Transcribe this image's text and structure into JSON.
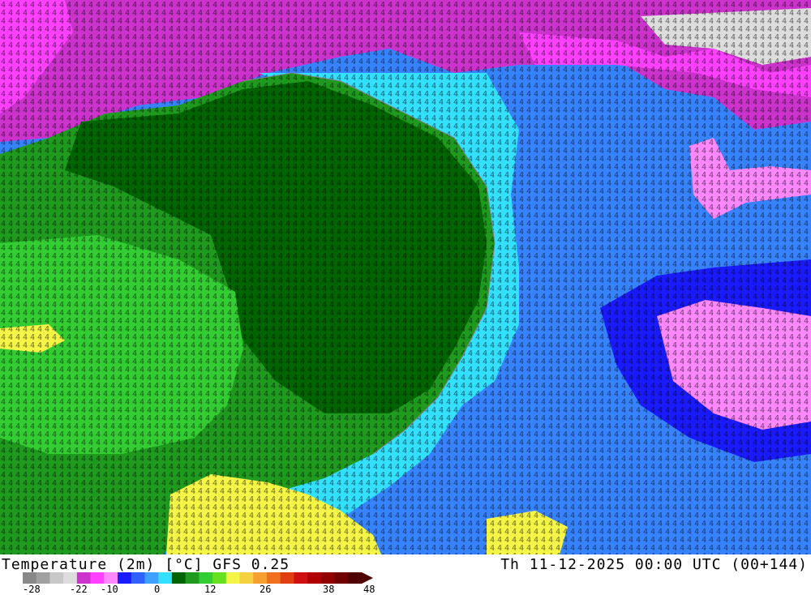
{
  "map": {
    "field": "temperature-2m",
    "overlay": "numeric-grid-labels",
    "colors": {
      "very_cold": "#ff40ff",
      "cold_magenta": "#cc33cc",
      "deep_blue": "#1a1aff",
      "blue": "#3060ff",
      "light_blue": "#3ea0ff",
      "cyan": "#33e0ff",
      "dark_green": "#006400",
      "green": "#1f9a1f",
      "light_green": "#33cc33",
      "yellow": "#f5f547",
      "grid_ink": "#000000",
      "coast": "#808080"
    }
  },
  "footer": {
    "title_left": "Temperature (2m) [°C] GFS 0.25",
    "title_right": "Th 11-12-2025 00:00 UTC (00+144)",
    "scale_labels": [
      "-28",
      "-22",
      "-10",
      "0",
      "12",
      "26",
      "38",
      "48"
    ],
    "scale_colors": [
      "#888888",
      "#a0a0a0",
      "#c8c8c8",
      "#dddddd",
      "#cc33cc",
      "#ff40ff",
      "#ff88ff",
      "#1a1aff",
      "#3060ff",
      "#3ea0ff",
      "#33e0ff",
      "#006400",
      "#1f9a1f",
      "#33cc33",
      "#66e01f",
      "#f5f547",
      "#f5d040",
      "#f5a030",
      "#f07020",
      "#e04010",
      "#d01010",
      "#b00000",
      "#900000",
      "#700000",
      "#500000"
    ]
  }
}
